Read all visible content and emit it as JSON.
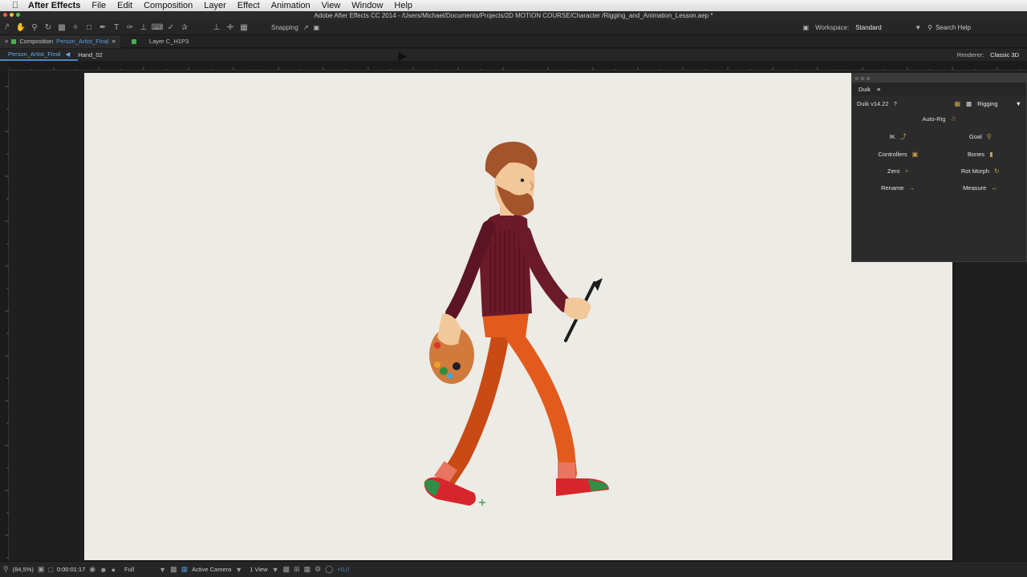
{
  "menubar": {
    "app_name": "After Effects",
    "items": [
      "File",
      "Edit",
      "Composition",
      "Layer",
      "Effect",
      "Animation",
      "View",
      "Window",
      "Help"
    ]
  },
  "window": {
    "title": "Adobe After Effects CC 2014 - /Users/Michael/Documents/Projects/2D MOTION COURSE/Character /Rigging_and_Animation_Lesson.aep *"
  },
  "toolbar": {
    "snapping_label": "Snapping",
    "workspace_label": "Workspace:",
    "workspace_value": "Standard",
    "search_placeholder": "Search Help"
  },
  "panel_tabs": {
    "composition_label": "Composition",
    "composition_name": "Person_Artist_Final",
    "layer_tab": "Layer C_H1P3"
  },
  "comp_nav": {
    "crumb_active": "Person_Artist_Final",
    "crumb_next": "Hand_02",
    "renderer_label": "Renderer:",
    "renderer_value": "Classic 3D"
  },
  "duik": {
    "panel_title": "Duik",
    "version": "Duik v14.22",
    "help": "?",
    "mode": "Rigging",
    "auto_rig": "Auto-Rig",
    "buttons": [
      {
        "label": "IK",
        "icon": "ik-icon"
      },
      {
        "label": "Goal",
        "icon": "goal-icon"
      },
      {
        "label": "Controllers",
        "icon": "controllers-icon"
      },
      {
        "label": "Bones",
        "icon": "bones-icon"
      },
      {
        "label": "Zero",
        "icon": "zero-icon"
      },
      {
        "label": "Rot Morph",
        "icon": "rotmorph-icon"
      },
      {
        "label": "Rename",
        "icon": "rename-icon"
      },
      {
        "label": "Measure",
        "icon": "measure-icon"
      }
    ]
  },
  "statusbar": {
    "zoom": "(84,5%)",
    "timecode": "0:00:01:17",
    "resolution": "Full",
    "camera": "Active Camera",
    "views": "1 View",
    "exposure": "+0,0"
  },
  "colors": {
    "accent_blue": "#4e86c6",
    "canvas_bg": "#ecebe6",
    "duik_icon": "#c6a24a"
  }
}
